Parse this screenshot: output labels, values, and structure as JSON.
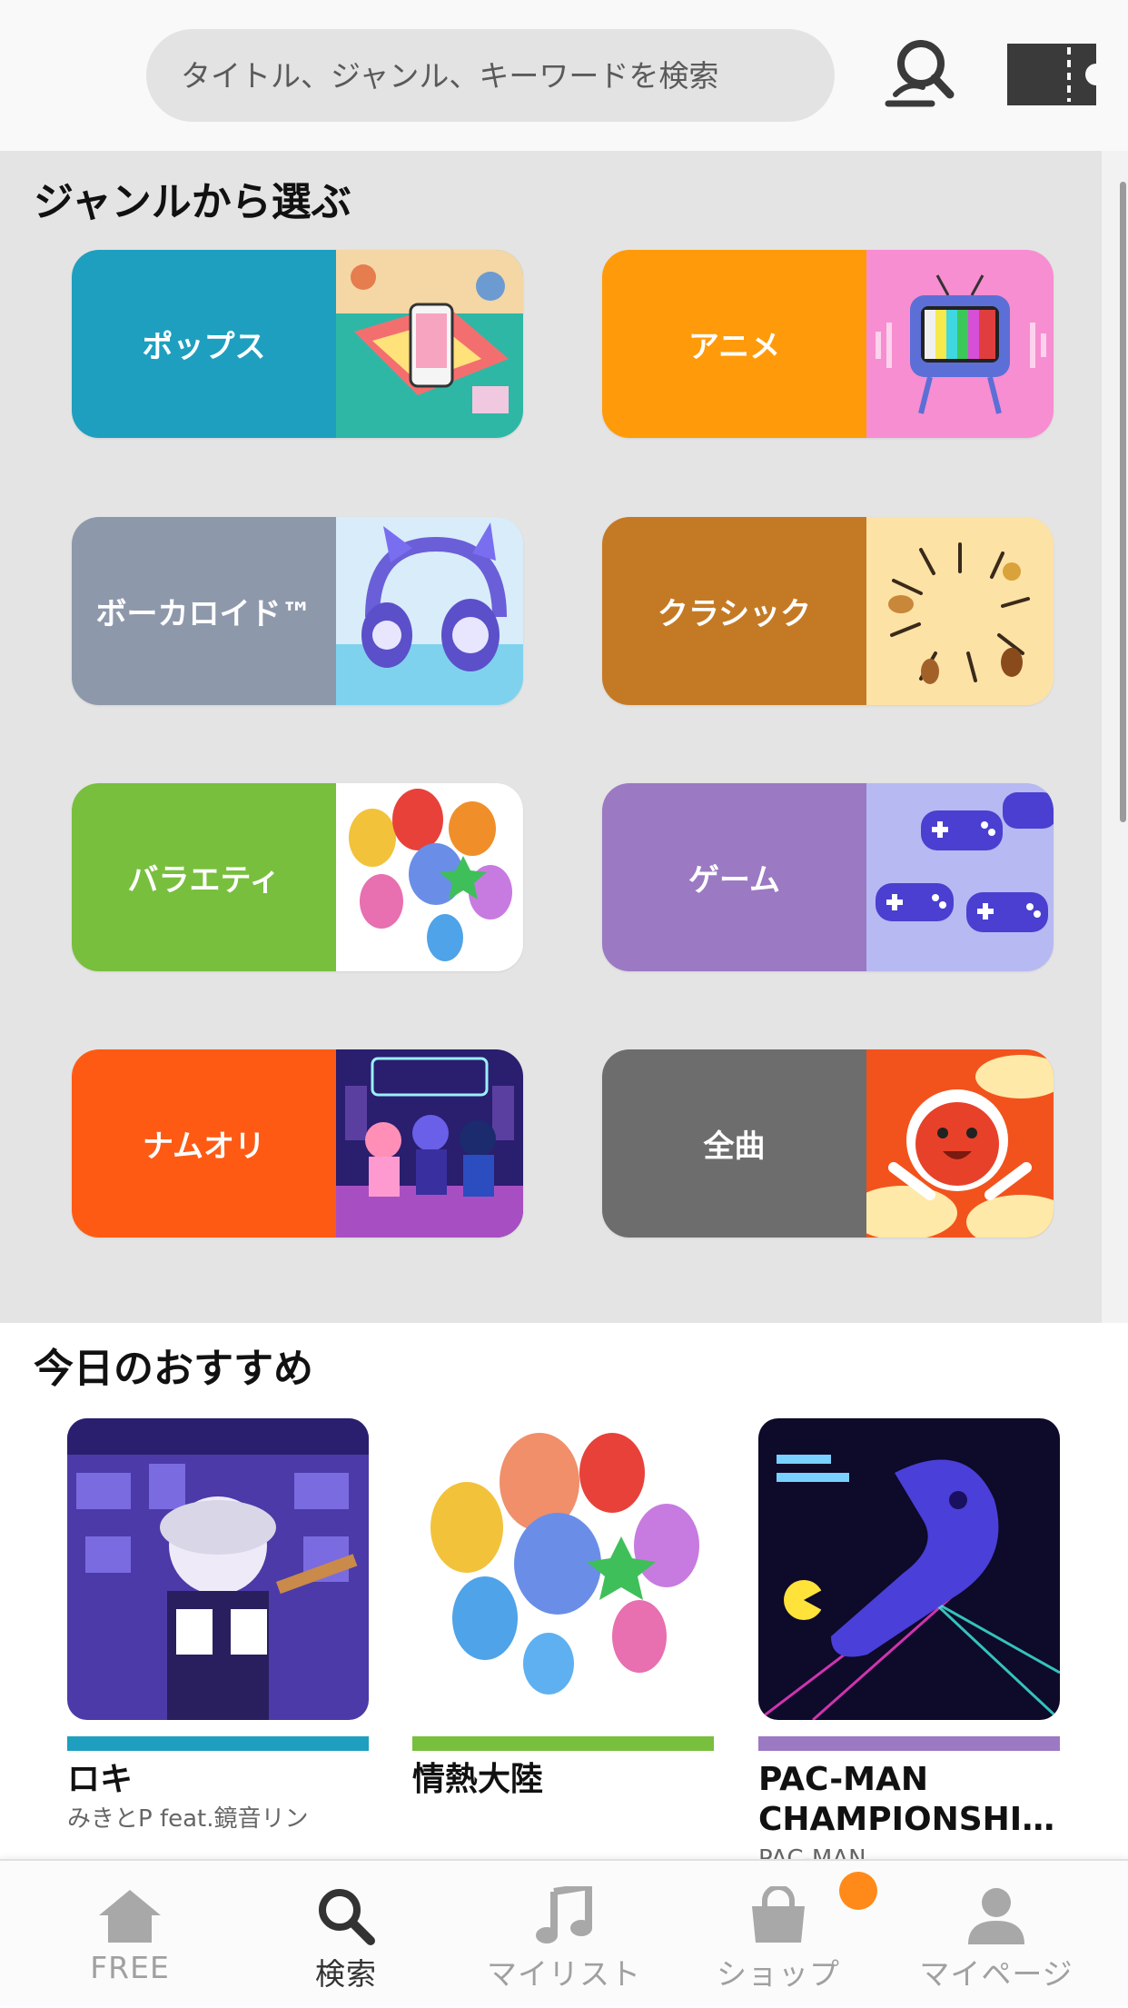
{
  "search": {
    "placeholder": "タイトル、ジャンル、キーワードを検索",
    "search_icon": "search-person-icon",
    "ticket_icon": "ticket-icon"
  },
  "genre_section": {
    "title": "ジャンルから選ぶ",
    "genres": [
      {
        "label": "ポップス",
        "color": "#1e9fbf"
      },
      {
        "label": "アニメ",
        "color": "#ff9a0a"
      },
      {
        "label": "ボーカロイド™",
        "color": "#8e98ab"
      },
      {
        "label": "クラシック",
        "color": "#c47a24"
      },
      {
        "label": "バラエティ",
        "color": "#78bf3e"
      },
      {
        "label": "ゲーム",
        "color": "#9b79c3"
      },
      {
        "label": "ナムオリ",
        "color": "#ff5a14"
      },
      {
        "label": "全曲",
        "color": "#6d6d6d"
      }
    ]
  },
  "recommend_section": {
    "title": "今日のおすすめ",
    "items": [
      {
        "title": "ロキ",
        "subtitle": "みきとP feat.鏡音リン",
        "bar_color": "#1e9fbf"
      },
      {
        "title": "情熱大陸",
        "subtitle": "",
        "bar_color": "#78bf3e"
      },
      {
        "title": "PAC-MAN CHAMPIONSHI…",
        "subtitle": "PAC-MAN",
        "bar_color": "#9b79c3"
      }
    ]
  },
  "bottom_nav": {
    "items": [
      {
        "label": "FREE",
        "icon": "home-icon",
        "active": false
      },
      {
        "label": "検索",
        "icon": "search-icon",
        "active": true
      },
      {
        "label": "マイリスト",
        "icon": "music-note-icon",
        "active": false
      },
      {
        "label": "ショップ",
        "icon": "shopping-bag-icon",
        "active": false
      },
      {
        "label": "マイページ",
        "icon": "user-icon",
        "active": false
      }
    ],
    "badge_color": "#ff8a1a"
  }
}
